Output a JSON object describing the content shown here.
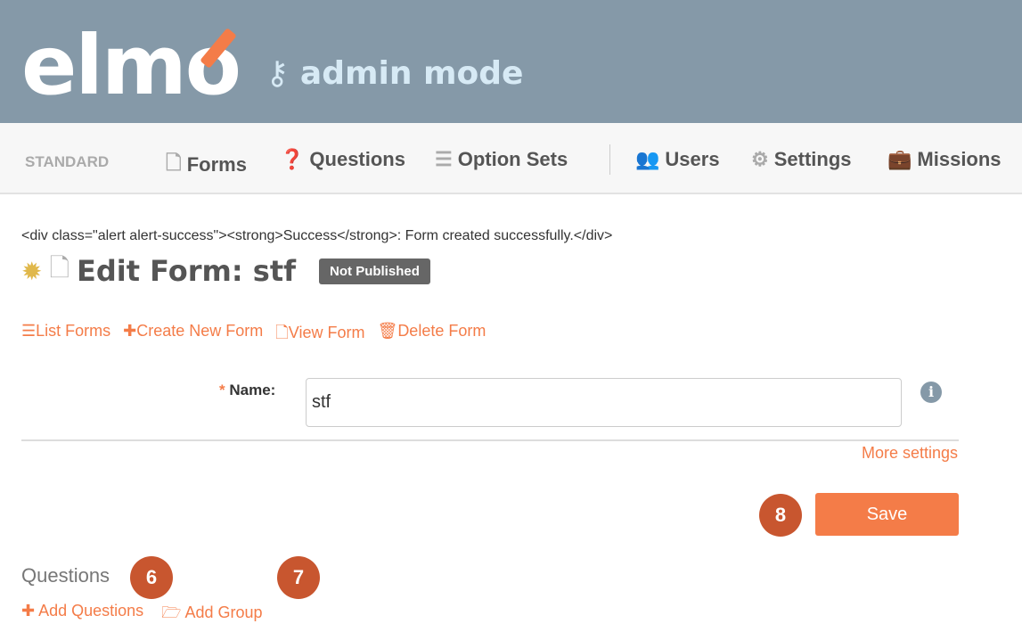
{
  "header": {
    "logo": "elmo",
    "mode": "admin mode"
  },
  "nav": {
    "standard": "STANDARD",
    "items": [
      "Forms",
      "Questions",
      "Option Sets",
      "Users",
      "Settings",
      "Missions"
    ]
  },
  "message": "<div class=\"alert alert-success\"><strong>Success</strong>: Form created successfully.</div>",
  "page": {
    "title": "Edit Form: stf",
    "status": "Not Published"
  },
  "actions": [
    "List Forms",
    "Create New Form",
    "View Form",
    "Delete Form"
  ],
  "form": {
    "name_label": "Name:",
    "name_required": "*",
    "name_value": "stf",
    "more_settings": "More settings",
    "save": "Save"
  },
  "questions": {
    "heading": "Questions",
    "add_questions": "Add Questions",
    "add_group": "Add Group"
  },
  "markers": [
    "6",
    "7",
    "8"
  ]
}
